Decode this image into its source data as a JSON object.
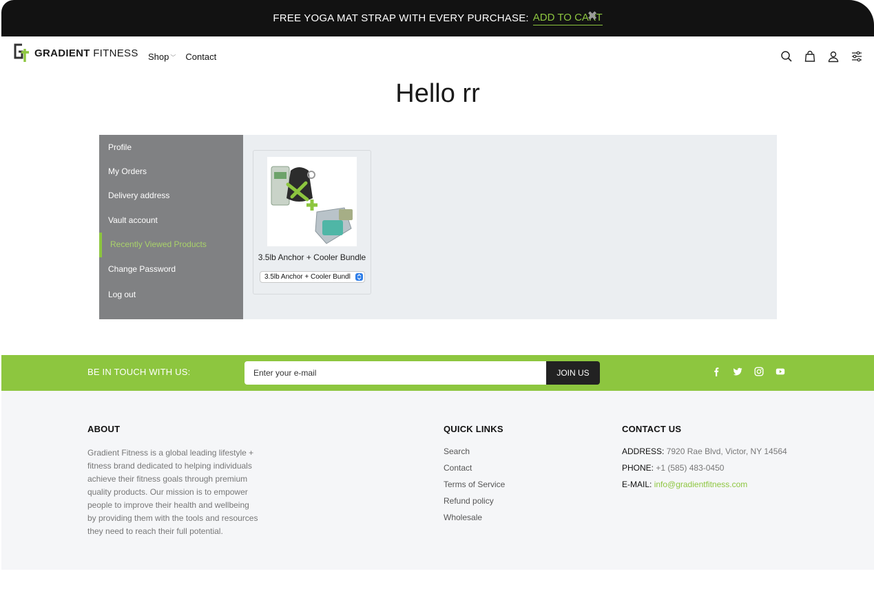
{
  "announcement": {
    "message": "FREE YOGA MAT STRAP WITH EVERY PURCHASE:",
    "cta": "ADD TO CART",
    "close_icon": "close-icon"
  },
  "header": {
    "logo_bold": "GRADIENT",
    "logo_light": "FITNESS",
    "nav": [
      {
        "label": "Shop",
        "has_dropdown": true
      },
      {
        "label": "Contact",
        "has_dropdown": false
      }
    ],
    "icons": [
      "search-icon",
      "shopping-bag-icon",
      "user-icon",
      "filter-sliders-icon"
    ]
  },
  "page": {
    "title": "Hello rr"
  },
  "account_menu": {
    "items": [
      {
        "label": "Profile"
      },
      {
        "label": "My Orders"
      },
      {
        "label": "Delivery address"
      },
      {
        "label": "Vault account"
      },
      {
        "label": "Recently Viewed Products",
        "active": true
      },
      {
        "label": "Change Password"
      },
      {
        "label": "Log out"
      }
    ]
  },
  "products": [
    {
      "name": "3.5lb Anchor + Cooler Bundle",
      "selected_variant": "3.5lb Anchor + Cooler Bundl"
    }
  ],
  "newsletter": {
    "label": "BE IN TOUCH WITH US:",
    "placeholder": "Enter your e-mail",
    "button": "JOIN US",
    "social": [
      "facebook-icon",
      "twitter-icon",
      "instagram-icon",
      "youtube-icon"
    ]
  },
  "footer": {
    "about": {
      "heading": "ABOUT",
      "text": "Gradient Fitness is a global leading lifestyle + fitness brand dedicated to helping individuals achieve their fitness goals through premium quality products. Our mission is to empower people to improve their health and wellbeing by providing them with the tools and resources they need to reach their full potential."
    },
    "quick_links": {
      "heading": "QUICK LINKS",
      "items": [
        "Search",
        "Contact",
        "Terms of Service",
        "Refund policy",
        "Wholesale"
      ]
    },
    "contact": {
      "heading": "CONTACT US",
      "address_label": "ADDRESS:",
      "address": "7920 Rae Blvd, Victor, NY 14564",
      "phone_label": "PHONE:",
      "phone": "+1 (585) 483-0450",
      "email_label": "E-MAIL:",
      "email": "info@gradientfitness.com"
    }
  },
  "colors": {
    "brand_green": "#8dc63f",
    "announcement_bg": "#121212",
    "sidebar_bg": "#808183",
    "panel_bg": "#ebeef1",
    "footer_bg": "#f5f6f8"
  }
}
